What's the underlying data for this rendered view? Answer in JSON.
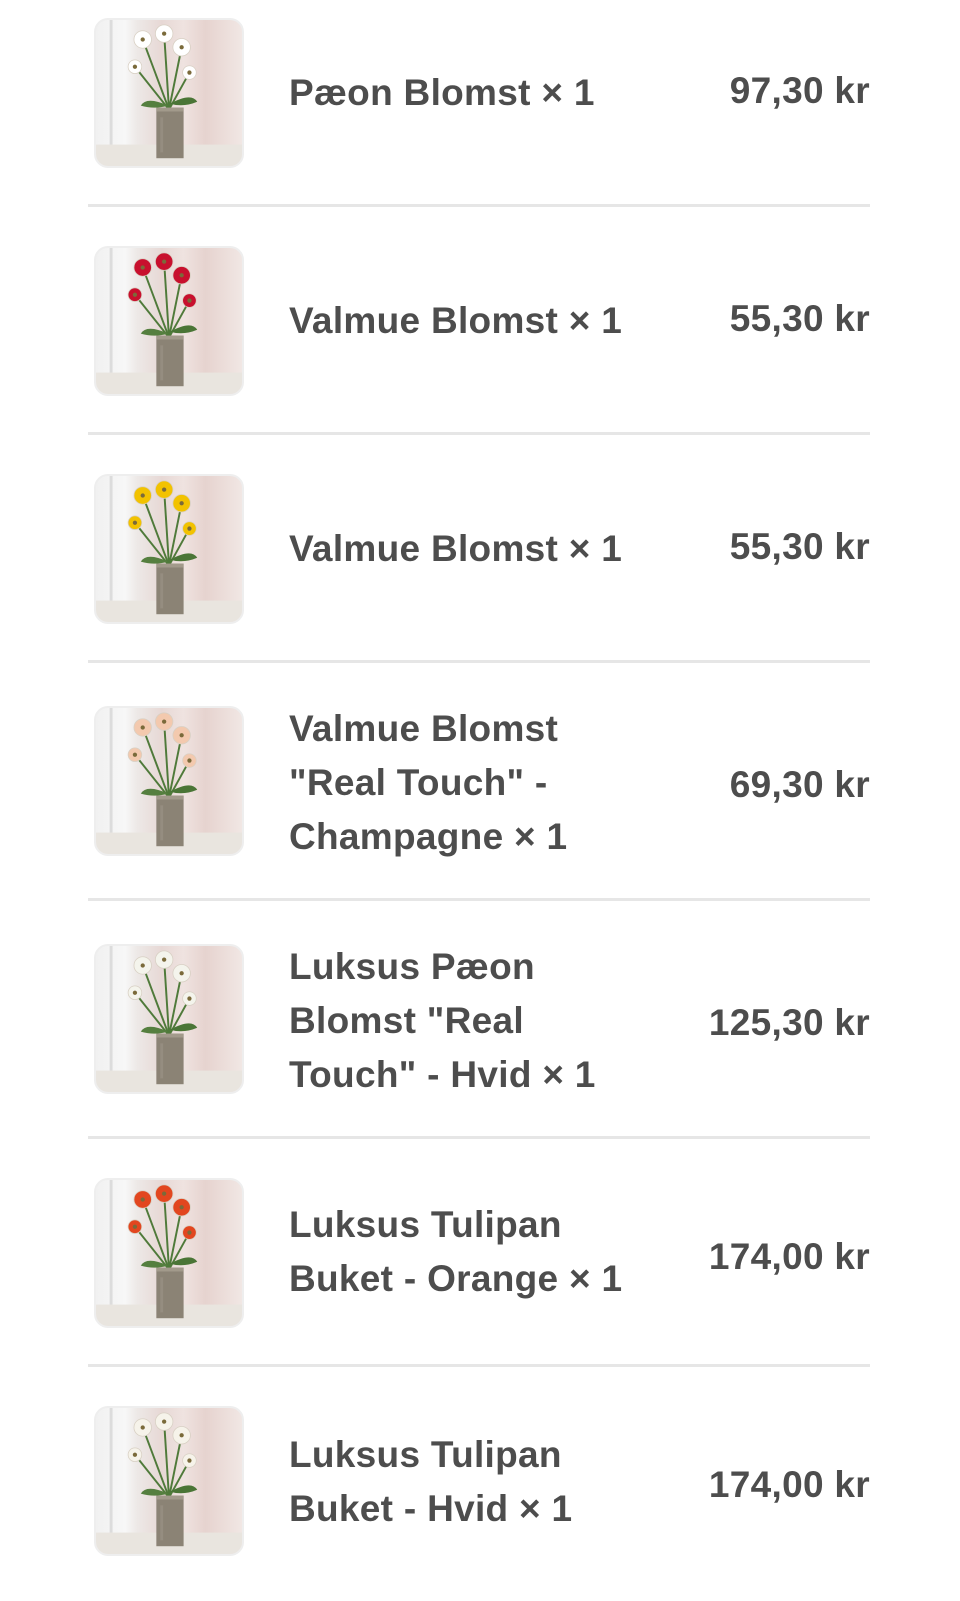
{
  "items": [
    {
      "title": "Pæon Blomst × 1",
      "price": "97,30 kr",
      "flower_color": "#ffffff",
      "image": "white-peony-vase-image"
    },
    {
      "title": "Valmue Blomst × 1",
      "price": "55,30 kr",
      "flower_color": "#c8102e",
      "image": "red-poppy-vase-image"
    },
    {
      "title": "Valmue Blomst × 1",
      "price": "55,30 kr",
      "flower_color": "#f2c200",
      "image": "yellow-poppy-vase-image"
    },
    {
      "title": "Valmue Blomst \"Real Touch\" - Champagne × 1",
      "price": "69,30 kr",
      "flower_color": "#f3c9ae",
      "image": "champagne-poppy-vase-image"
    },
    {
      "title": "Luksus Pæon Blomst \"Real Touch\" - Hvid × 1",
      "price": "125,30 kr",
      "flower_color": "#f4f4ec",
      "image": "white-peony-bouquet-vase-image"
    },
    {
      "title": "Luksus Tulipan Buket - Orange × 1",
      "price": "174,00 kr",
      "flower_color": "#e2461f",
      "image": "orange-tulip-vase-image"
    },
    {
      "title": "Luksus Tulipan Buket - Hvid × 1",
      "price": "174,00 kr",
      "flower_color": "#f6f3ea",
      "image": "white-tulip-vase-image"
    }
  ]
}
